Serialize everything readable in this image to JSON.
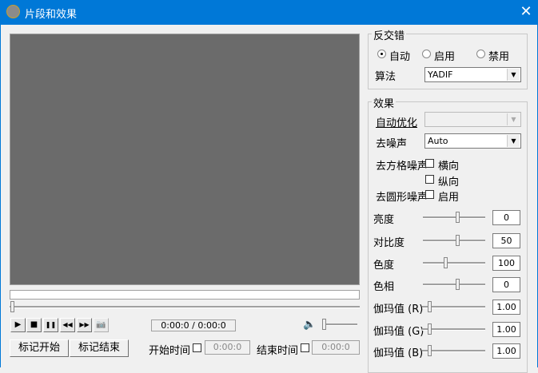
{
  "window": {
    "title": "片段和效果",
    "close": "✕"
  },
  "player": {
    "time": "0:00:0 / 0:00:0",
    "buttons": {
      "play": "▶",
      "stop": "■",
      "pause": "❚❚",
      "rewind": "◀◀",
      "forward": "▶▶",
      "snapshot": "📷"
    }
  },
  "marks": {
    "start_button": "标记开始",
    "end_button": "标记结束",
    "start_time_label": "开始时间",
    "start_time": "0:00:0",
    "end_time_label": "结束时间",
    "end_time": "0:00:0"
  },
  "deinterlace": {
    "title": "反交错",
    "options": [
      {
        "label": "自动",
        "selected": true
      },
      {
        "label": "启用",
        "selected": false
      },
      {
        "label": "禁用",
        "selected": false
      }
    ],
    "algorithm_label": "算法",
    "algorithm": "YADIF"
  },
  "effects": {
    "title": "效果",
    "auto_optimize_label": "自动优化",
    "auto_optimize": "",
    "denoise_label": "去噪声",
    "denoise": "Auto",
    "deblock_label": "去方格噪声",
    "deblock_h": "横向",
    "deblock_v": "纵向",
    "dering_label": "去圆形噪声",
    "dering_enable": "启用",
    "sliders": [
      {
        "label": "亮度",
        "value": "0",
        "fraction": 0.55
      },
      {
        "label": "对比度",
        "value": "50",
        "fraction": 0.55
      },
      {
        "label": "色度",
        "value": "100",
        "fraction": 0.36
      },
      {
        "label": "色相",
        "value": "0",
        "fraction": 0.55
      },
      {
        "label": "伽玛值 (R)",
        "value": "1.00",
        "fraction": 0.12
      },
      {
        "label": "伽玛值 (G)",
        "value": "1.00",
        "fraction": 0.12
      },
      {
        "label": "伽玛值 (B)",
        "value": "1.00",
        "fraction": 0.12
      }
    ]
  },
  "seek_fraction": 0,
  "volume_fraction": 0
}
